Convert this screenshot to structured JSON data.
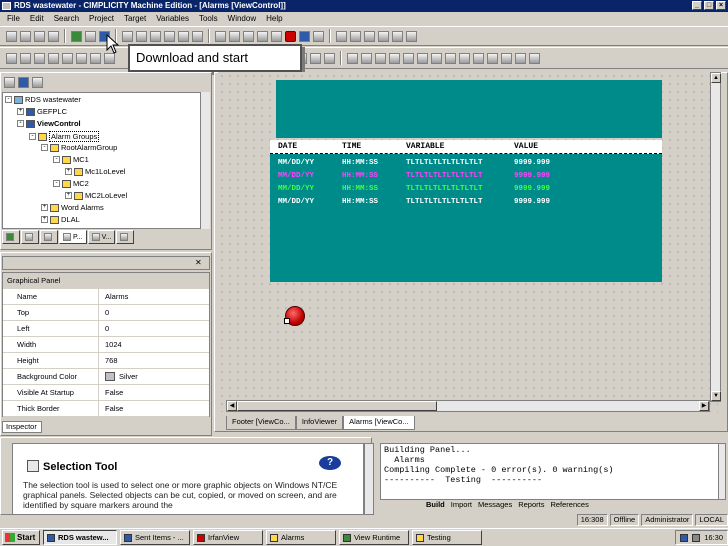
{
  "window": {
    "title": "RDS wastewater - CIMPLICITY Machine Edition - [Alarms [ViewControl]]"
  },
  "menu": [
    "File",
    "Edit",
    "Search",
    "Project",
    "Target",
    "Variables",
    "Tools",
    "Window",
    "Help"
  ],
  "tooltip": "Download and start",
  "tree": {
    "items": [
      {
        "label": "RDS wastewater"
      },
      {
        "label": "GEFPLC"
      },
      {
        "label": "ViewControl"
      },
      {
        "label": "Alarm Groups"
      },
      {
        "label": "RootAlarmGroup"
      },
      {
        "label": "MC1"
      },
      {
        "label": "Mc1LoLevel"
      },
      {
        "label": "MC2"
      },
      {
        "label": "MC2LoLevel"
      },
      {
        "label": "Word Alarms"
      },
      {
        "label": "DLAL"
      }
    ],
    "tabs": [
      "",
      "",
      "",
      "P...",
      "V...",
      ""
    ]
  },
  "inspector": {
    "title": "Graphical Panel",
    "label": "Inspector",
    "rows": [
      {
        "key": "Name",
        "value": "Alarms"
      },
      {
        "key": "Top",
        "value": "0"
      },
      {
        "key": "Left",
        "value": "0"
      },
      {
        "key": "Width",
        "value": "1024"
      },
      {
        "key": "Height",
        "value": "768"
      },
      {
        "key": "Background Color",
        "value": "Silver"
      },
      {
        "key": "Visible At Startup",
        "value": "False"
      },
      {
        "key": "Thick Border",
        "value": "False"
      }
    ]
  },
  "alarm_table": {
    "headers": [
      "DATE",
      "TIME",
      "VARIABLE",
      "VALUE"
    ],
    "rows": [
      {
        "date": "MM/DD/YY",
        "time": "HH:MM:SS",
        "variable": "TLTLTLTLTLTLTLTLT",
        "value": "9999.999",
        "color": "#ffffff"
      },
      {
        "date": "MM/DD/YY",
        "time": "HH:MM:SS",
        "variable": "TLTLTLTLTLTLTLTLT",
        "value": "9999.999",
        "color": "#ff40ff"
      },
      {
        "date": "MM/DD/YY",
        "time": "HH:MM:SS",
        "variable": "TLTLTLTLTLTLTLTLT",
        "value": "9999.999",
        "color": "#40ff40"
      },
      {
        "date": "MM/DD/YY",
        "time": "HH:MM:SS",
        "variable": "TLTLTLTLTLTLTLTLT",
        "value": "9999.999",
        "color": "#ffffff"
      }
    ]
  },
  "doc_tabs": [
    "Footer [ViewCo...",
    "InfoViewer",
    "Alarms [ViewCo..."
  ],
  "help": {
    "title": "Selection Tool",
    "body": "The selection tool is used to select one or more graphic objects on Windows NT/CE graphical panels. Selected objects can be cut, copied, or moved on screen, and are identified by square markers around the"
  },
  "output": {
    "lines": [
      "Building Panel...",
      "  Alarms",
      "",
      "Compiling Complete - 0 error(s). 0 warning(s)",
      "",
      "----------  Testing  ----------"
    ],
    "tabs": [
      "Build",
      "Import",
      "Messages",
      "Reports",
      "References"
    ]
  },
  "status": [
    "16:308",
    "Offline",
    "Administrator",
    "LOCAL"
  ],
  "taskbar": {
    "start": "Start",
    "tasks": [
      {
        "label": "RDS wastew...",
        "active": true
      },
      {
        "label": "Sent Items - ...",
        "active": false
      },
      {
        "label": "IrfanView",
        "active": false
      },
      {
        "label": "Alarms",
        "active": false
      },
      {
        "label": "View Runtime",
        "active": false
      },
      {
        "label": "Testing",
        "active": false
      }
    ],
    "clock": "16:30"
  }
}
